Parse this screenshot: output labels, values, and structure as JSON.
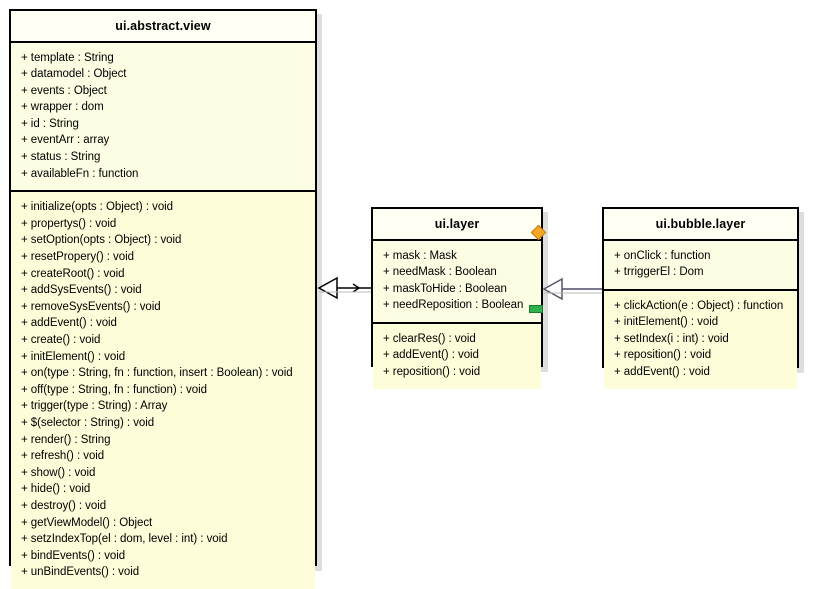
{
  "diagram": {
    "kind": "uml-class-diagram",
    "background_color": "#ffffff",
    "class_fill_color": "#fdfde8",
    "class_border_color": "#000000",
    "handle_colors": {
      "anchor": "#f5a623",
      "resize": "#2fb04a"
    }
  },
  "classes": [
    {
      "id": "abstract-view",
      "name": "ui.abstract.view",
      "attributes": [
        "+ template : String",
        "+ datamodel : Object",
        "+ events : Object",
        "+ wrapper : dom",
        "+ id : String",
        "+ eventArr : array",
        "+ status : String",
        "+ availableFn : function"
      ],
      "methods": [
        "+ initialize(opts : Object) : void",
        "+ propertys() : void",
        "+ setOption(opts : Object) : void",
        "+ resetPropery() : void",
        "+ createRoot() : void",
        "+ addSysEvents() : void",
        "+ removeSysEvents() : void",
        "+ addEvent() : void",
        "+ create() : void",
        "+ initElement() : void",
        "+ on(type : String, fn : function, insert : Boolean) : void",
        "+ off(type : String, fn : function) : void",
        "+ trigger(type : String) : Array",
        "+ $(selector : String) : void",
        "+ render() : String",
        "+ refresh() : void",
        "+ show() : void",
        "+ hide() : void",
        "+ destroy() : void",
        "+ getViewModel() : Object",
        "+ setzIndexTop(el : dom, level : int) : void",
        "+ bindEvents() : void",
        "+ unBindEvents() : void"
      ]
    },
    {
      "id": "layer",
      "name": "ui.layer",
      "attributes": [
        "+ mask : Mask",
        "+ needMask : Boolean",
        "+ maskToHide : Boolean",
        "+ needReposition : Boolean"
      ],
      "methods": [
        "+ clearRes() : void",
        "+ addEvent() : void",
        "+ reposition() : void"
      ]
    },
    {
      "id": "bubble-layer",
      "name": "ui.bubble.layer",
      "attributes": [
        "+ onClick : function",
        "+ trriggerEl : Dom"
      ],
      "methods": [
        "+ clickAction(e : Object) : function",
        "+ initElement() : void",
        "+ setIndex(i : int) : void",
        "+ reposition() : void",
        "+ addEvent() : void"
      ]
    }
  ],
  "relationships": [
    {
      "id": "layer-extends-abstract-view",
      "type": "generalization",
      "from": "ui.layer",
      "to": "ui.abstract.view"
    },
    {
      "id": "bubble-layer-extends-layer",
      "type": "generalization",
      "from": "ui.bubble.layer",
      "to": "ui.layer"
    }
  ]
}
